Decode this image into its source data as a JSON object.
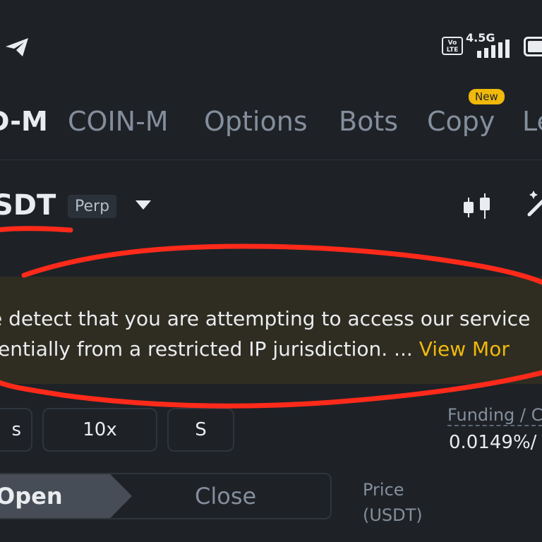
{
  "status_bar": {
    "network_type": "4.5G",
    "volte_label": "Vo LTE",
    "icons": [
      "telegram-icon",
      "volte-icon",
      "signal-icon",
      "battery-icon"
    ]
  },
  "tabs": [
    {
      "label": "D-M",
      "active": true
    },
    {
      "label": "COIN-M",
      "active": false
    },
    {
      "label": "Options",
      "active": false
    },
    {
      "label": "Bots",
      "active": false
    },
    {
      "label": "Copy",
      "active": false,
      "badge": "New"
    },
    {
      "label": "Le",
      "active": false
    }
  ],
  "symbol": {
    "name": "SDT",
    "type": "Perp"
  },
  "banner": {
    "line1": "e detect that you are attempting to access our service",
    "line2_prefix": "tentially from a restricted IP jurisdiction. ... ",
    "link": "View Mor"
  },
  "controls": {
    "margin_mode": "s",
    "leverage": "10x",
    "asset_mode": "S"
  },
  "funding": {
    "label": "Funding / C",
    "value": "0.0149%/"
  },
  "order_side": {
    "open": "Open",
    "close": "Close"
  },
  "order_book": {
    "price_label": "Price",
    "price_unit": "(USDT)"
  },
  "colors": {
    "background": "#1e2227",
    "accent": "#f0b90b",
    "sell": "#f6465d",
    "annotation": "#ff2a1a"
  }
}
